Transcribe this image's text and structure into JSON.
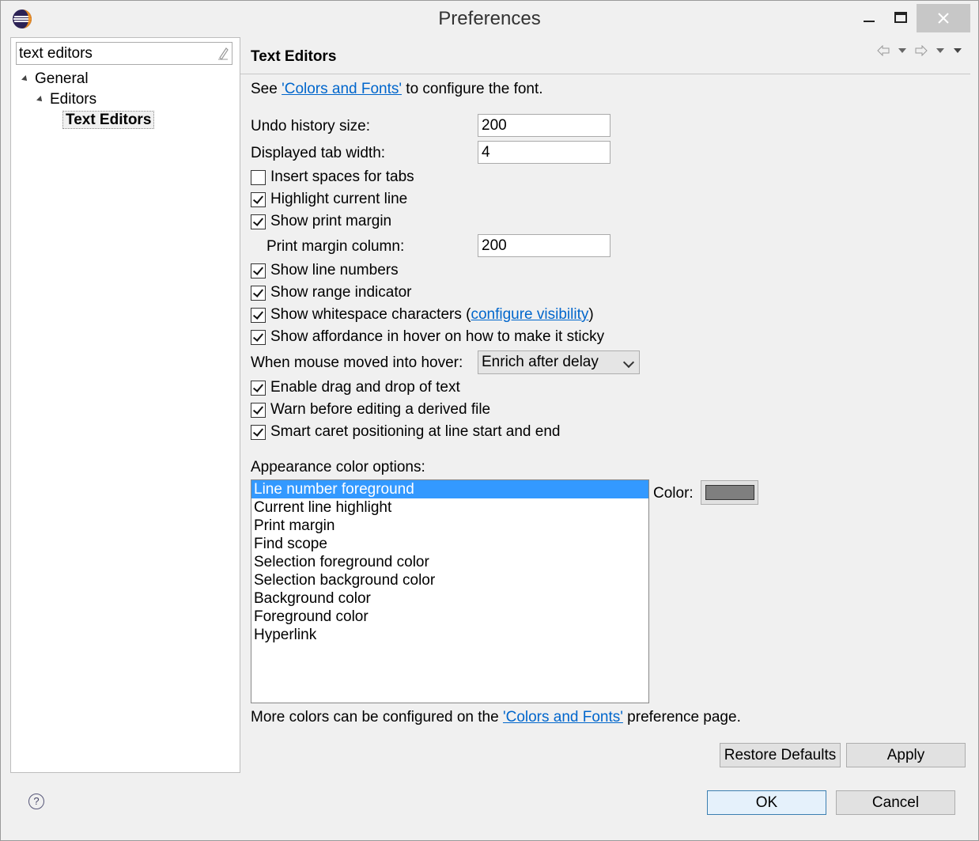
{
  "window": {
    "title": "Preferences"
  },
  "filter": {
    "value": "text editors"
  },
  "tree": {
    "items": [
      {
        "label": "General"
      },
      {
        "label": "Editors"
      },
      {
        "label": "Text Editors"
      }
    ]
  },
  "page": {
    "title": "Text Editors",
    "font_note": {
      "prefix": "See ",
      "link": "'Colors and Fonts'",
      "suffix": " to configure the font."
    },
    "undo_label": "Undo history size:",
    "undo_value": "200",
    "tab_width_label": "Displayed tab width:",
    "tab_width_value": "4",
    "insert_spaces": "Insert spaces for tabs",
    "highlight_line": "Highlight current line",
    "show_margin": "Show print margin",
    "margin_col_label": "Print margin column:",
    "margin_col_value": "200",
    "show_line_numbers": "Show line numbers",
    "show_range": "Show range indicator",
    "show_ws_prefix": "Show whitespace characters (",
    "show_ws_link": "configure visibility",
    "show_ws_suffix": ")",
    "affordance": "Show affordance in hover on how to make it sticky",
    "hover_label": "When mouse moved into hover:",
    "hover_value": "Enrich after delay",
    "drag_drop": "Enable drag and drop of text",
    "warn_derived": "Warn before editing a derived file",
    "smart_caret": "Smart caret positioning at line start and end",
    "appearance_label": "Appearance color options:",
    "color_label": "Color:",
    "color_value": "#7f7f7f",
    "color_options": [
      "Line number foreground",
      "Current line highlight",
      "Print margin",
      "Find scope",
      "Selection foreground color",
      "Selection background color",
      "Background color",
      "Foreground color",
      "Hyperlink"
    ],
    "more_colors": {
      "prefix": "More colors can be configured on the ",
      "link": "'Colors and Fonts'",
      "suffix": " preference page."
    },
    "restore_defaults": "Restore Defaults",
    "apply": "Apply"
  },
  "footer": {
    "help": "?",
    "ok": "OK",
    "cancel": "Cancel"
  }
}
